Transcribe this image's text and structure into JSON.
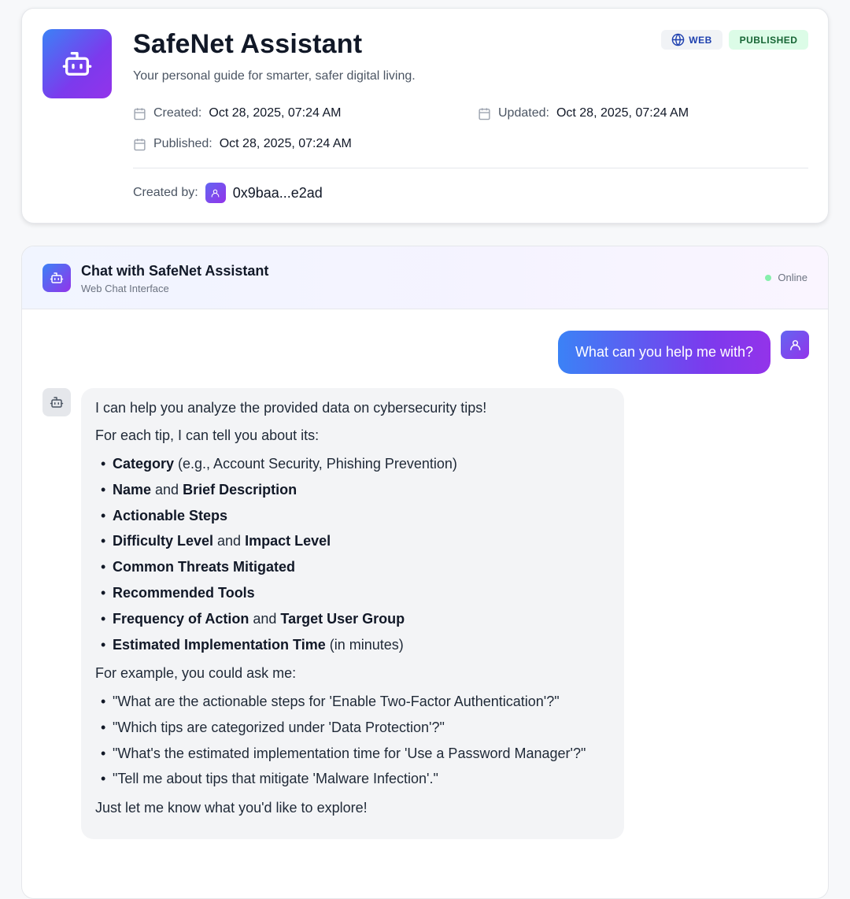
{
  "agent": {
    "name": "SafeNet Assistant",
    "tagline": "Your personal guide for smarter, safer digital living.",
    "badge_web": "WEB",
    "badge_status": "PUBLISHED",
    "created_label": "Created:",
    "created_value": "Oct 28, 2025, 07:24 AM",
    "updated_label": "Updated:",
    "updated_value": "Oct 28, 2025, 07:24 AM",
    "published_label": "Published:",
    "published_value": "Oct 28, 2025, 07:24 AM",
    "created_by_label": "Created by:",
    "creator_address": "0x9baa...e2ad"
  },
  "chat": {
    "title": "Chat with SafeNet Assistant",
    "subtitle": "Web Chat Interface",
    "status": "Online",
    "user_message": "What can you help me with?",
    "bot": {
      "intro": "I can help you analyze the provided data on cybersecurity tips!",
      "each_tip": "For each tip, I can tell you about its:",
      "fields": [
        {
          "a": "Category",
          "b": " (e.g., Account Security, Phishing Prevention)",
          "c": "",
          "d": ""
        },
        {
          "a": "Name",
          "b": " and ",
          "c": "Brief Description",
          "d": ""
        },
        {
          "a": "Actionable Steps",
          "b": "",
          "c": "",
          "d": ""
        },
        {
          "a": "Difficulty Level",
          "b": " and ",
          "c": "Impact Level",
          "d": ""
        },
        {
          "a": "Common Threats Mitigated",
          "b": "",
          "c": "",
          "d": ""
        },
        {
          "a": "Recommended Tools",
          "b": "",
          "c": "",
          "d": ""
        },
        {
          "a": "Frequency of Action",
          "b": " and ",
          "c": "Target User Group",
          "d": ""
        },
        {
          "a": "Estimated Implementation Time",
          "b": " (in minutes)",
          "c": "",
          "d": ""
        }
      ],
      "example_intro": "For example, you could ask me:",
      "examples": [
        "\"What are the actionable steps for 'Enable Two-Factor Authentication'?\"",
        "\"Which tips are categorized under 'Data Protection'?\"",
        "\"What's the estimated implementation time for 'Use a Password Manager'?\"",
        "\"Tell me about tips that mitigate 'Malware Infection'.\""
      ],
      "closing": "Just let me know what you'd like to explore!"
    }
  },
  "icons": {
    "agent": "robot-icon",
    "web": "globe-icon",
    "calendar": "calendar-icon",
    "user": "user-icon"
  },
  "colors": {
    "accent_start": "#3b82f6",
    "accent_end": "#9333ea",
    "published_bg": "#dcfce7",
    "published_text": "#166534",
    "online": "#86efac"
  }
}
